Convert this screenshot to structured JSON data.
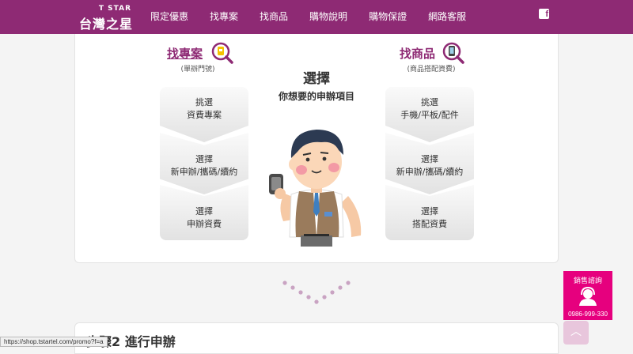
{
  "brand": {
    "en": "T STAR",
    "zh": "台灣之星"
  },
  "nav": [
    {
      "label": "限定優惠"
    },
    {
      "label": "找專案"
    },
    {
      "label": "找商品"
    },
    {
      "label": "購物說明"
    },
    {
      "label": "購物保證"
    },
    {
      "label": "網路客服"
    }
  ],
  "facebook": {
    "glyph": "f"
  },
  "left": {
    "title": "找專案",
    "sub": "(單辦門號)",
    "steps": [
      {
        "line1": "挑選",
        "line2": "資費專案"
      },
      {
        "line1": "選擇",
        "line2": "新申辦/攜碼/續約"
      },
      {
        "line1": "選擇",
        "line2": "申辦資費"
      }
    ]
  },
  "center": {
    "title": "選擇",
    "sub": "你想要的申辦項目"
  },
  "right": {
    "title": "找商品",
    "sub": "(商品搭配資費)",
    "steps": [
      {
        "line1": "挑選",
        "line2": "手機/平板/配件"
      },
      {
        "line1": "選擇",
        "line2": "新申辦/攜碼/續約"
      },
      {
        "line1": "選擇",
        "line2": "搭配資費"
      }
    ]
  },
  "section2": {
    "title": "步驟2 進行申辦"
  },
  "status_bar": {
    "url": "https://shop.tstartel.com/promo?f=a"
  },
  "sales": {
    "label": "銷售諮詢",
    "phone": "0986-999-330"
  },
  "to_top": {
    "glyph": "︿"
  },
  "colors": {
    "brand": "#8e2a74",
    "accent": "#e6007e",
    "dots": "#c9a3c2"
  }
}
